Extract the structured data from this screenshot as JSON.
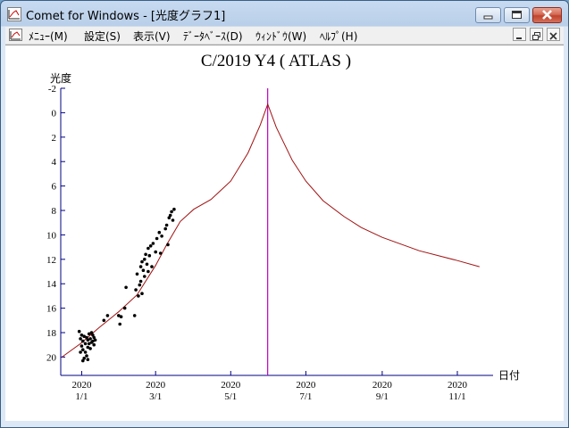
{
  "window": {
    "title": "Comet for Windows - [光度グラフ1]"
  },
  "menu": {
    "items": [
      "ﾒﾆｭｰ(M)",
      "設定(S)",
      "表示(V)",
      "ﾃﾞｰﾀﾍﾞｰｽ(D)",
      "ｳｨﾝﾄﾞｳ(W)",
      "ﾍﾙﾌﾟ(H)"
    ]
  },
  "icons": {
    "app": "graph-icon",
    "minimize": "minimize-icon",
    "maximize": "maximize-icon",
    "close": "close-icon",
    "mdi_restore": "restore-icon"
  },
  "colors": {
    "curve": "#a01010",
    "perihelion_line": "#c000c0",
    "points": "#000000",
    "axes": "#000080"
  },
  "chart_data": {
    "type": "scatter",
    "title": "C/2019 Y4 ( ATLAS )",
    "ylabel": "光度",
    "xlabel": "日付",
    "ylim": [
      -2,
      21.5
    ],
    "y_inverted": true,
    "y_ticks": [
      "-2",
      "0",
      "2",
      "4",
      "6",
      "8",
      "10",
      "12",
      "14",
      "16",
      "18",
      "20"
    ],
    "x_ticks": [
      {
        "date": "2020-01-01",
        "year": "2020",
        "label": "1/1"
      },
      {
        "date": "2020-03-01",
        "year": "2020",
        "label": "3/1"
      },
      {
        "date": "2020-05-01",
        "year": "2020",
        "label": "5/1"
      },
      {
        "date": "2020-07-01",
        "year": "2020",
        "label": "7/1"
      },
      {
        "date": "2020-09-01",
        "year": "2020",
        "label": "9/1"
      },
      {
        "date": "2020-11-01",
        "year": "2020",
        "label": "11/1"
      }
    ],
    "xlim": [
      "2019-12-15",
      "2020-11-30"
    ],
    "perihelion_date": "2020-05-31",
    "predicted_curve": [
      [
        "2019-12-16",
        20.0
      ],
      [
        "2019-12-31",
        18.9
      ],
      [
        "2020-01-15",
        17.6
      ],
      [
        "2020-01-31",
        16.3
      ],
      [
        "2020-02-15",
        14.9
      ],
      [
        "2020-03-01",
        12.5
      ],
      [
        "2020-03-10",
        10.8
      ],
      [
        "2020-03-21",
        8.9
      ],
      [
        "2020-04-01",
        7.9
      ],
      [
        "2020-04-15",
        7.1
      ],
      [
        "2020-05-01",
        5.6
      ],
      [
        "2020-05-15",
        3.3
      ],
      [
        "2020-05-25",
        1.0
      ],
      [
        "2020-05-31",
        -0.7
      ],
      [
        "2020-06-07",
        1.2
      ],
      [
        "2020-06-20",
        3.9
      ],
      [
        "2020-07-01",
        5.6
      ],
      [
        "2020-07-15",
        7.2
      ],
      [
        "2020-08-01",
        8.5
      ],
      [
        "2020-08-15",
        9.4
      ],
      [
        "2020-09-01",
        10.2
      ],
      [
        "2020-10-01",
        11.3
      ],
      [
        "2020-11-01",
        12.1
      ],
      [
        "2020-11-19",
        12.6
      ]
    ],
    "observations": [
      [
        "2019-12-30",
        17.9
      ],
      [
        "2019-12-31",
        18.5
      ],
      [
        "2020-01-01",
        18.2
      ],
      [
        "2020-01-01",
        19.1
      ],
      [
        "2020-01-02",
        18.7
      ],
      [
        "2020-01-02",
        19.4
      ],
      [
        "2020-01-03",
        18.3
      ],
      [
        "2020-01-03",
        20.1
      ],
      [
        "2020-01-04",
        18.9
      ],
      [
        "2020-01-04",
        19.6
      ],
      [
        "2020-01-05",
        18.4
      ],
      [
        "2020-01-05",
        19.9
      ],
      [
        "2020-01-06",
        18.6
      ],
      [
        "2020-01-06",
        19.2
      ],
      [
        "2020-01-07",
        18.1
      ],
      [
        "2020-01-07",
        18.9
      ],
      [
        "2020-01-08",
        18.5
      ],
      [
        "2020-01-08",
        19.3
      ],
      [
        "2020-01-09",
        18.8
      ],
      [
        "2020-01-10",
        18.2
      ],
      [
        "2020-01-10",
        18.7
      ],
      [
        "2020-01-11",
        19.0
      ],
      [
        "2020-01-12",
        18.6
      ],
      [
        "2019-12-31",
        19.6
      ],
      [
        "2020-01-02",
        20.3
      ],
      [
        "2020-01-06",
        20.2
      ],
      [
        "2020-01-09",
        18.0
      ],
      [
        "2020-01-11",
        18.4
      ],
      [
        "2020-01-19",
        17.0
      ],
      [
        "2020-01-22",
        16.6
      ],
      [
        "2020-01-31",
        16.6
      ],
      [
        "2020-02-01",
        17.3
      ],
      [
        "2020-02-02",
        16.7
      ],
      [
        "2020-02-05",
        16.0
      ],
      [
        "2020-02-06",
        14.3
      ],
      [
        "2020-02-13",
        16.6
      ],
      [
        "2020-02-14",
        14.5
      ],
      [
        "2020-02-15",
        13.2
      ],
      [
        "2020-02-16",
        15.0
      ],
      [
        "2020-02-17",
        14.1
      ],
      [
        "2020-02-18",
        12.6
      ],
      [
        "2020-02-18",
        13.8
      ],
      [
        "2020-02-19",
        12.2
      ],
      [
        "2020-02-19",
        14.8
      ],
      [
        "2020-02-20",
        12.9
      ],
      [
        "2020-02-21",
        12.0
      ],
      [
        "2020-02-21",
        13.4
      ],
      [
        "2020-02-22",
        11.6
      ],
      [
        "2020-02-23",
        12.4
      ],
      [
        "2020-02-24",
        11.1
      ],
      [
        "2020-02-24",
        13.0
      ],
      [
        "2020-02-25",
        11.7
      ],
      [
        "2020-02-26",
        10.9
      ],
      [
        "2020-02-27",
        12.6
      ],
      [
        "2020-02-28",
        10.7
      ],
      [
        "2020-03-01",
        11.4
      ],
      [
        "2020-03-02",
        10.3
      ],
      [
        "2020-03-04",
        9.8
      ],
      [
        "2020-03-05",
        11.5
      ],
      [
        "2020-03-06",
        10.1
      ],
      [
        "2020-03-09",
        9.5
      ],
      [
        "2020-03-10",
        9.2
      ],
      [
        "2020-03-11",
        10.8
      ],
      [
        "2020-03-12",
        8.6
      ],
      [
        "2020-03-13",
        8.4
      ],
      [
        "2020-03-14",
        8.1
      ],
      [
        "2020-03-15",
        8.8
      ],
      [
        "2020-03-16",
        7.9
      ]
    ]
  }
}
